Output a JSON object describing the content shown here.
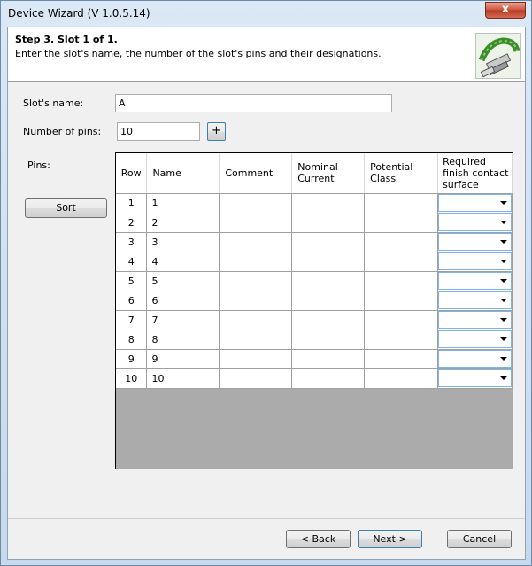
{
  "window": {
    "title": "Device Wizard (V 1.0.5.14)",
    "close_label": "x"
  },
  "header": {
    "step_title": "Step 3. Slot 1 of 1.",
    "description": "Enter the slot's name, the number of the slot's pins and their designations."
  },
  "form": {
    "slot_name_label": "Slot's name:",
    "slot_name_value": "A",
    "num_pins_label": "Number of pins:",
    "num_pins_value": "10",
    "add_label": "+",
    "pins_label": "Pins:",
    "sort_label": "Sort"
  },
  "table": {
    "columns": [
      "Row",
      "Name",
      "Comment",
      "Nominal Current",
      "Potential Class",
      "Required finish contact surface"
    ],
    "rows": [
      {
        "row": "1",
        "name": "1"
      },
      {
        "row": "2",
        "name": "2"
      },
      {
        "row": "3",
        "name": "3"
      },
      {
        "row": "4",
        "name": "4"
      },
      {
        "row": "5",
        "name": "5"
      },
      {
        "row": "6",
        "name": "6"
      },
      {
        "row": "7",
        "name": "7"
      },
      {
        "row": "8",
        "name": "8"
      },
      {
        "row": "9",
        "name": "9"
      },
      {
        "row": "10",
        "name": "10"
      }
    ]
  },
  "footer": {
    "back_label": "< Back",
    "next_label": "Next >",
    "cancel_label": "Cancel"
  }
}
